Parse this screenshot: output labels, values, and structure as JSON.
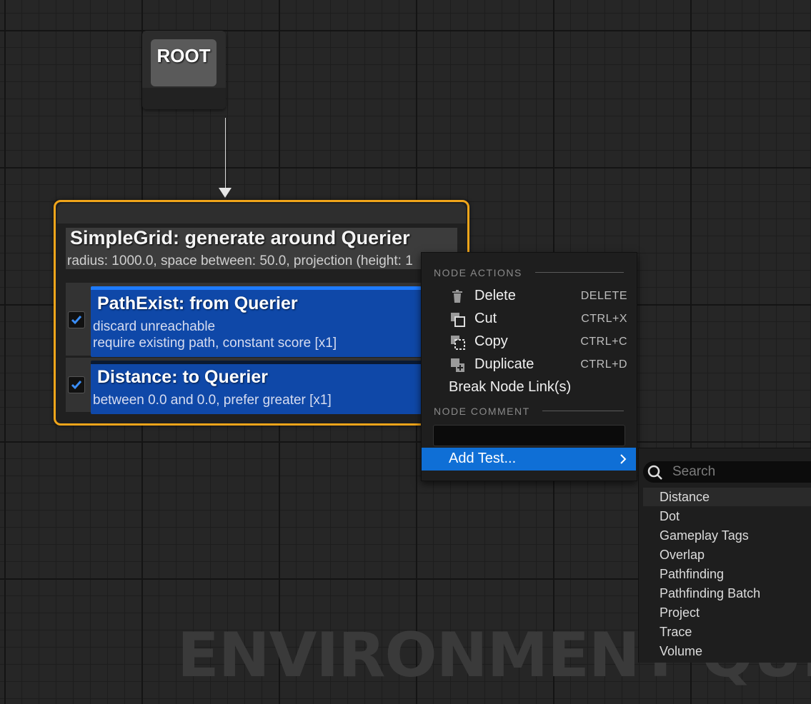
{
  "graph": {
    "watermark": "ENVIRONMENT QUERY",
    "root": {
      "label": "ROOT"
    },
    "generator": {
      "title": "SimpleGrid: generate around Querier",
      "subtitle": "radius: 1000.0, space between: 50.0, projection (height: 1"
    },
    "tests": [
      {
        "title": "PathExist: from Querier",
        "lines": [
          "discard unreachable",
          "require existing path, constant score [x1]"
        ],
        "checked": true
      },
      {
        "title": "Distance: to Querier",
        "lines": [
          "between 0.0 and 0.0, prefer greater [x1]"
        ],
        "checked": true
      }
    ]
  },
  "context_menu": {
    "node_actions_header": "NODE ACTIONS",
    "items": [
      {
        "label": "Delete",
        "shortcut": "DELETE",
        "icon": "trash-icon"
      },
      {
        "label": "Cut",
        "shortcut": "CTRL+X",
        "icon": "cut-icon"
      },
      {
        "label": "Copy",
        "shortcut": "CTRL+C",
        "icon": "copy-icon"
      },
      {
        "label": "Duplicate",
        "shortcut": "CTRL+D",
        "icon": "duplicate-icon"
      },
      {
        "label": "Break Node Link(s)",
        "shortcut": ""
      }
    ],
    "node_comment_header": "NODE COMMENT",
    "comment_value": "",
    "add_test_label": "Add Test..."
  },
  "submenu": {
    "search_placeholder": "Search",
    "items": [
      "Distance",
      "Dot",
      "Gameplay Tags",
      "Overlap",
      "Pathfinding",
      "Pathfinding Batch",
      "Project",
      "Trace",
      "Volume"
    ],
    "highlighted_index": 0
  },
  "colors": {
    "accent_blue": "#0f6fd6",
    "node_selected_border": "#f0a51a",
    "test_card": "#0f48a8"
  }
}
